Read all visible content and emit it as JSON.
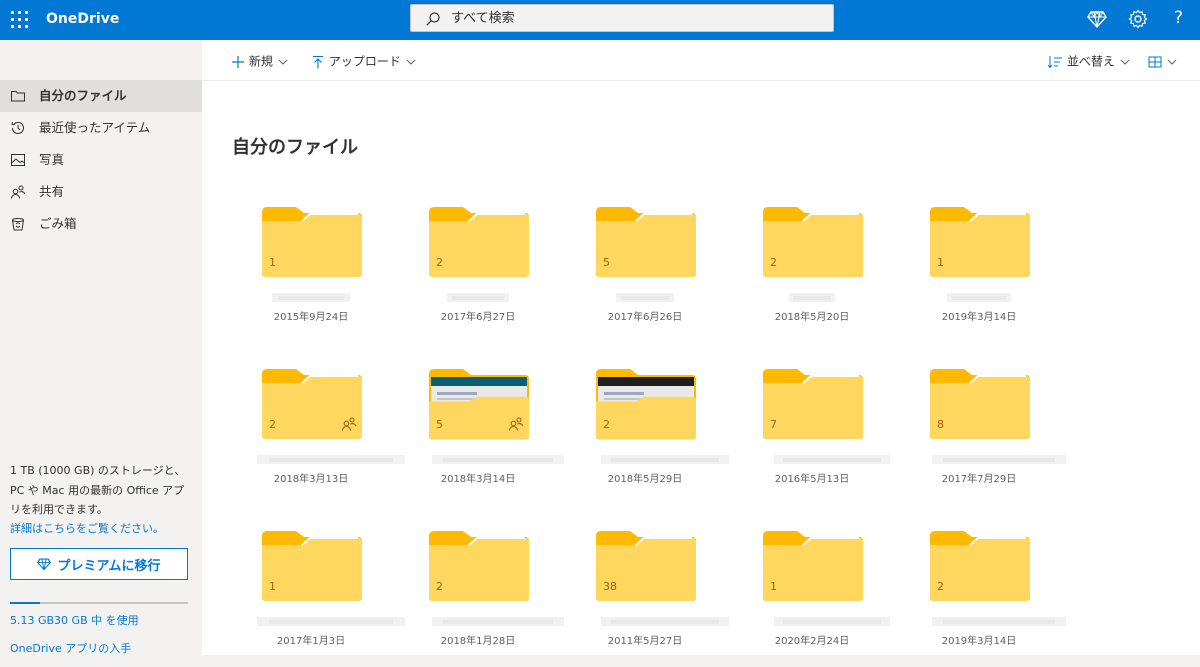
{
  "topbar": {
    "app_name": "OneDrive",
    "search_placeholder": "すべて検索",
    "help_label": "?"
  },
  "nav": {
    "items": [
      {
        "label": "自分のファイル",
        "icon": "folder-icon",
        "active": true
      },
      {
        "label": "最近使ったアイテム",
        "icon": "recent-icon",
        "active": false
      },
      {
        "label": "写真",
        "icon": "photo-icon",
        "active": false
      },
      {
        "label": "共有",
        "icon": "shared-icon",
        "active": false
      },
      {
        "label": "ごみ箱",
        "icon": "recycle-bin-icon",
        "active": false
      }
    ],
    "promo_text": "1 TB (1000 GB) のストレージと、PC や Mac 用の最新の Office アプリを利用できます。",
    "promo_link": "詳細はこちらをご覧ください。",
    "premium_label": "プレミアムに移行",
    "storage_text": "5.13 GB30 GB 中 を使用",
    "storage_fraction": 0.171,
    "app_link": "OneDrive アプリの入手"
  },
  "commands": {
    "new_label": "新規",
    "upload_label": "アップロード",
    "sort_label": "並べ替え"
  },
  "main": {
    "title": "自分のファイル"
  },
  "folders": [
    {
      "count": "1",
      "date": "2015年9月24日",
      "shared": false,
      "thumbnail": false
    },
    {
      "count": "2",
      "date": "2017年6月27日",
      "shared": false,
      "thumbnail": false
    },
    {
      "count": "5",
      "date": "2017年6月26日",
      "shared": false,
      "thumbnail": false
    },
    {
      "count": "2",
      "date": "2018年5月20日",
      "shared": false,
      "thumbnail": false
    },
    {
      "count": "1",
      "date": "2019年3月14日",
      "shared": false,
      "thumbnail": false
    },
    {
      "count": "2",
      "date": "2018年3月13日",
      "shared": true,
      "thumbnail": false
    },
    {
      "count": "5",
      "date": "2018年3月14日",
      "shared": true,
      "thumbnail": true
    },
    {
      "count": "2",
      "date": "2018年5月29日",
      "shared": false,
      "thumbnail": true
    },
    {
      "count": "7",
      "date": "2016年5月13日",
      "shared": false,
      "thumbnail": false
    },
    {
      "count": "8",
      "date": "2017年7月29日",
      "shared": false,
      "thumbnail": false
    },
    {
      "count": "1",
      "date": "2017年1月3日",
      "shared": false,
      "thumbnail": false
    },
    {
      "count": "2",
      "date": "2018年1月28日",
      "shared": false,
      "thumbnail": false
    },
    {
      "count": "38",
      "date": "2011年5月27日",
      "shared": false,
      "thumbnail": false
    },
    {
      "count": "1",
      "date": "2020年2月24日",
      "shared": false,
      "thumbnail": false
    },
    {
      "count": "2",
      "date": "2019年3月14日",
      "shared": false,
      "thumbnail": false
    }
  ],
  "colors": {
    "brand": "#0078d4",
    "folder_back": "#ffb900",
    "folder_front": "#ffd75e",
    "nav_bg": "#f3f2f1"
  }
}
